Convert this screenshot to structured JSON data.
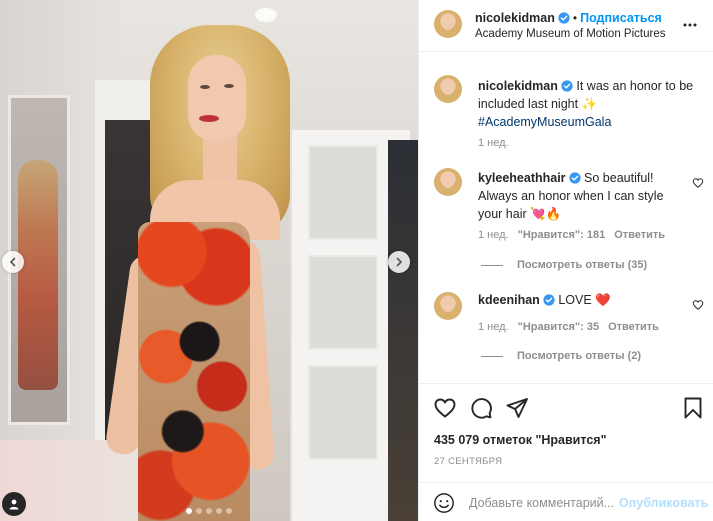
{
  "post": {
    "username": "nicolekidman",
    "follow_label": "Подписаться",
    "location": "Academy Museum of Motion Pictures",
    "caption_text": "It was an honor to be included last night ✨",
    "hashtag": "#AcademyMuseumGala",
    "caption_time": "1 нед.",
    "likes_text": "435 079 отметок \"Нравится\"",
    "date": "27 СЕНТЯБРЯ",
    "carousel": {
      "slides": 5,
      "active": 1
    }
  },
  "comments": [
    {
      "username": "kyleeheathhair",
      "text": "So beautiful! Always an honor when I can style your hair 💘🔥",
      "time": "1 нед.",
      "likes": "\"Нравится\": 181",
      "reply_label": "Ответить",
      "view_replies": "Посмотреть ответы (35)"
    },
    {
      "username": "kdeenihan",
      "text": "LOVE ❤️",
      "time": "1 нед.",
      "likes": "\"Нравится\": 35",
      "reply_label": "Ответить",
      "view_replies": "Посмотреть ответы (2)"
    }
  ],
  "add_comment": {
    "placeholder": "Добавьте комментарий...",
    "post_label": "Опубликовать"
  },
  "colors": {
    "accent": "#0095f6",
    "hashtag": "#00376b",
    "verified": "#3897f0",
    "muted": "#8e8e8e",
    "post_disabled": "#b2dffc"
  },
  "icons": [
    "more-icon",
    "heart-icon",
    "comment-icon",
    "share-icon",
    "bookmark-icon",
    "emoji-icon",
    "verified-icon",
    "chevron-left-icon",
    "chevron-right-icon",
    "user-tag-icon"
  ]
}
